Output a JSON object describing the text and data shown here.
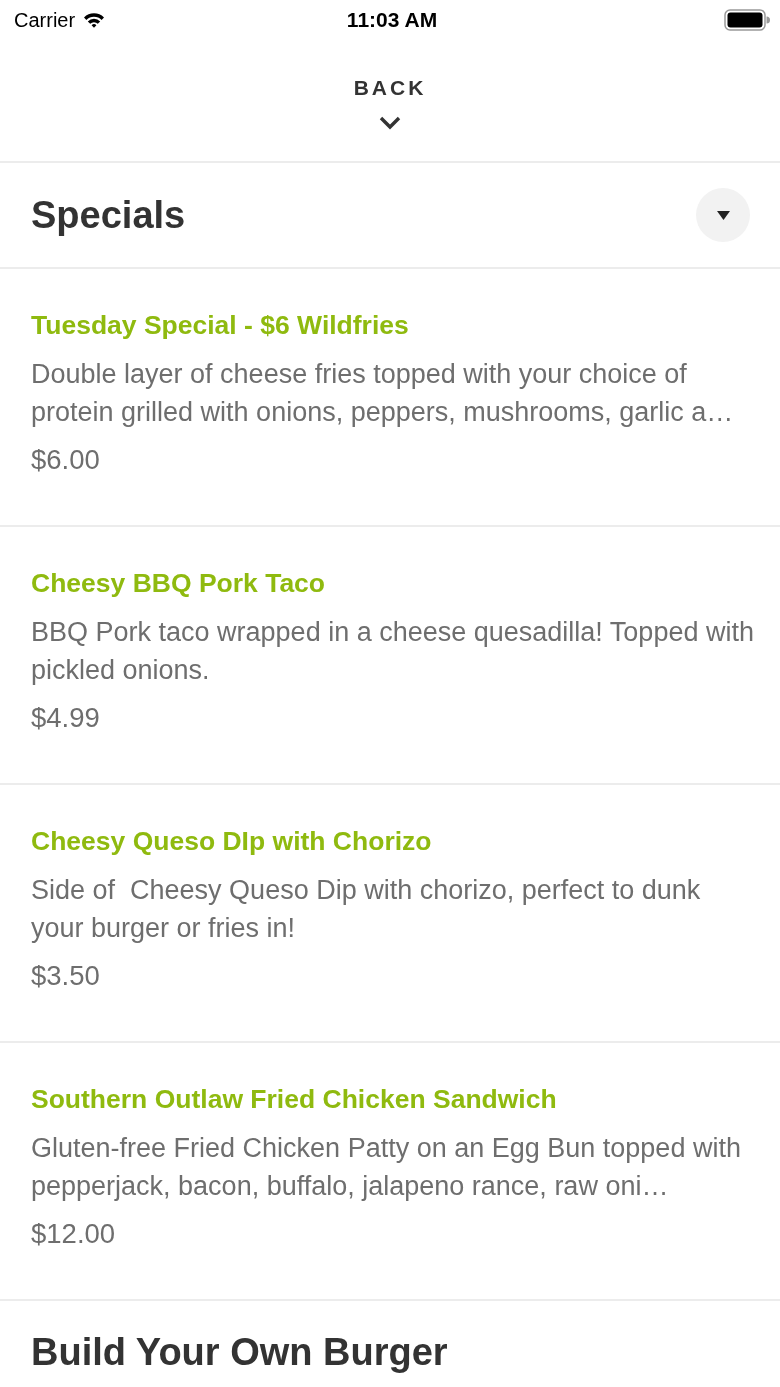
{
  "status_bar": {
    "carrier": "Carrier",
    "time": "11:03 AM"
  },
  "back_button": {
    "label": "BACK"
  },
  "sections": [
    {
      "title": "Specials",
      "dropdown": true,
      "items": [
        {
          "name": "Tuesday Special - $6 Wildfries",
          "description": "Double layer of cheese fries topped with your choice of protein grilled with onions, peppers, mushrooms, garlic a…",
          "price": "$6.00"
        },
        {
          "name": "Cheesy BBQ Pork Taco",
          "description": "BBQ Pork taco wrapped in a cheese quesadilla! Topped with pickled onions.",
          "price": "$4.99"
        },
        {
          "name": "Cheesy Queso DIp with Chorizo",
          "description": "Side of  Cheesy Queso Dip with chorizo, perfect to dunk your burger or fries in!",
          "price": "$3.50"
        },
        {
          "name": "Southern Outlaw Fried Chicken Sandwich",
          "description": "Gluten-free Fried Chicken Patty on an Egg Bun topped with pepperjack, bacon, buffalo, jalapeno rance, raw oni…",
          "price": "$12.00"
        }
      ]
    },
    {
      "title": "Build Your Own Burger",
      "dropdown": false
    }
  ]
}
